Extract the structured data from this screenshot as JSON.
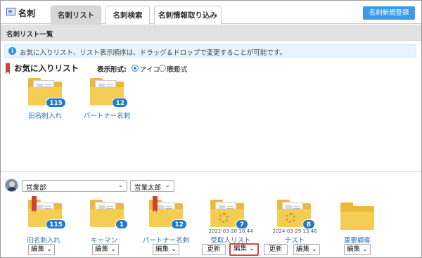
{
  "header": {
    "app_title": "名刺",
    "tabs": [
      "名刺リスト",
      "名刺検索",
      "名刺情報取り込み"
    ],
    "new_button": "名刺新規登録"
  },
  "subbar": {
    "title": "名刺リスト一覧"
  },
  "info": {
    "text": "お気に入りリスト、リスト表示順序は、ドラッグ＆ドロップで変更することが可能です。"
  },
  "favorites": {
    "title": "お気に入りリスト",
    "display_label": "表示形式:",
    "options": [
      "アイコン形式",
      "表形式"
    ],
    "selected": "アイコン形式",
    "items": [
      {
        "name": "旧名刺入れ",
        "count": "115"
      },
      {
        "name": "パートナー名刺",
        "count": "12"
      }
    ]
  },
  "filters": {
    "department": "営業部",
    "user": "営業太郎"
  },
  "lists": [
    {
      "name": "旧名刺入れ",
      "count": "115",
      "edit": "編集"
    },
    {
      "name": "キーマン",
      "count": "1",
      "edit": "編集"
    },
    {
      "name": "パートナー名刺",
      "count": "12",
      "edit": "編集"
    },
    {
      "name": "受取人リスト",
      "count": "7",
      "timestamp": "2022-03-28 10:44",
      "refresh": "更新",
      "edit": "編集"
    },
    {
      "name": "テスト",
      "count": "8",
      "timestamp": "2024-03-29 13:46",
      "refresh": "更新",
      "edit": "編集"
    },
    {
      "name": "重要顧客",
      "edit": "編集"
    }
  ]
}
